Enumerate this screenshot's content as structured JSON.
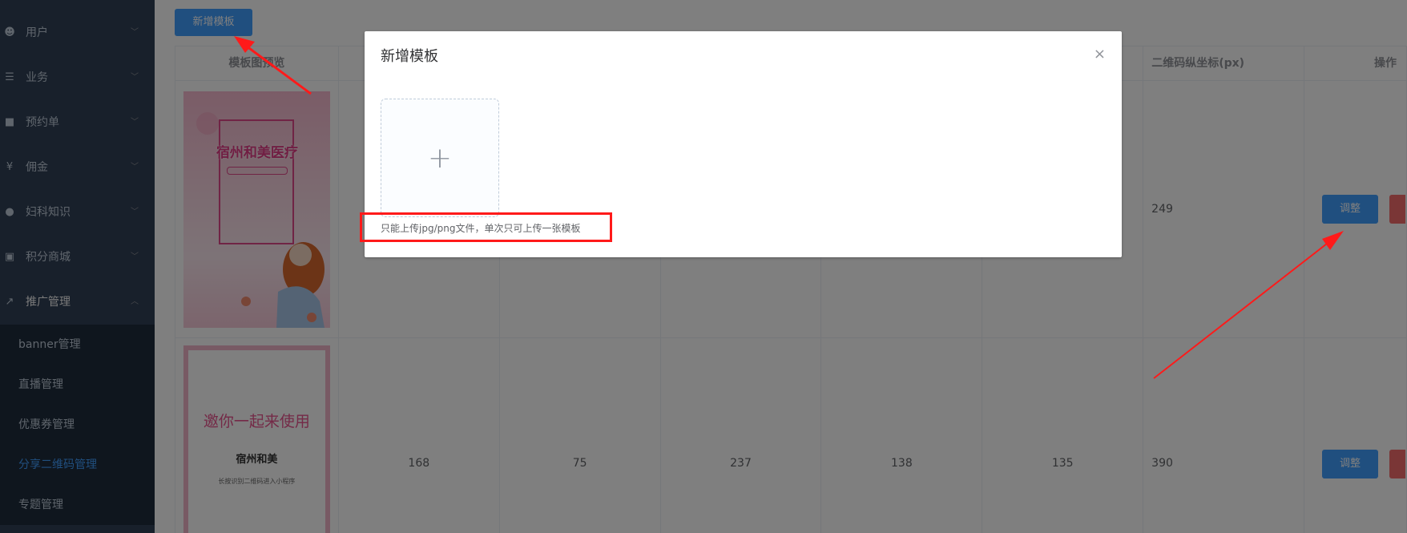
{
  "sidebar": {
    "items": [
      {
        "label": "用户",
        "icon": "user-icon",
        "glyph": "☻"
      },
      {
        "label": "业务",
        "icon": "list-icon",
        "glyph": "☰"
      },
      {
        "label": "预约单",
        "icon": "chat-icon",
        "glyph": "■"
      },
      {
        "label": "佣金",
        "icon": "yen-icon",
        "glyph": "¥"
      },
      {
        "label": "妇科知识",
        "icon": "globe-icon",
        "glyph": "●"
      },
      {
        "label": "积分商城",
        "icon": "cart-icon",
        "glyph": "▣"
      },
      {
        "label": "推广管理",
        "icon": "external-link-icon",
        "glyph": "↗"
      }
    ],
    "sub_items": [
      "banner管理",
      "直播管理",
      "优惠券管理",
      "分享二维码管理",
      "专题管理"
    ]
  },
  "toolbar": {
    "add_label": "新增模板"
  },
  "table": {
    "headers": [
      "模板图预览",
      "",
      "",
      "",
      "",
      "",
      "二维码纵坐标(px)",
      "操作"
    ],
    "rows": [
      {
        "cells": [
          "",
          "",
          "",
          "",
          "",
          "249"
        ],
        "action": "调整",
        "poster": {
          "title": "宿州和美医疗"
        }
      },
      {
        "cells": [
          "168",
          "75",
          "237",
          "138",
          "135",
          "390"
        ],
        "action": "调整",
        "poster": {
          "line1": "邀你一起来使用",
          "line2": "宿州和美",
          "line3": "长按识别二维码进入小程序"
        }
      }
    ]
  },
  "dialog": {
    "title": "新增模板",
    "close": "×",
    "upload_plus": "+",
    "tip": "只能上传jpg/png文件，单次只可上传一张模板"
  },
  "colors": {
    "primary": "#409eff",
    "danger": "#f56c6c",
    "annotation": "#ff1a1a",
    "sidebar": "#304156"
  }
}
